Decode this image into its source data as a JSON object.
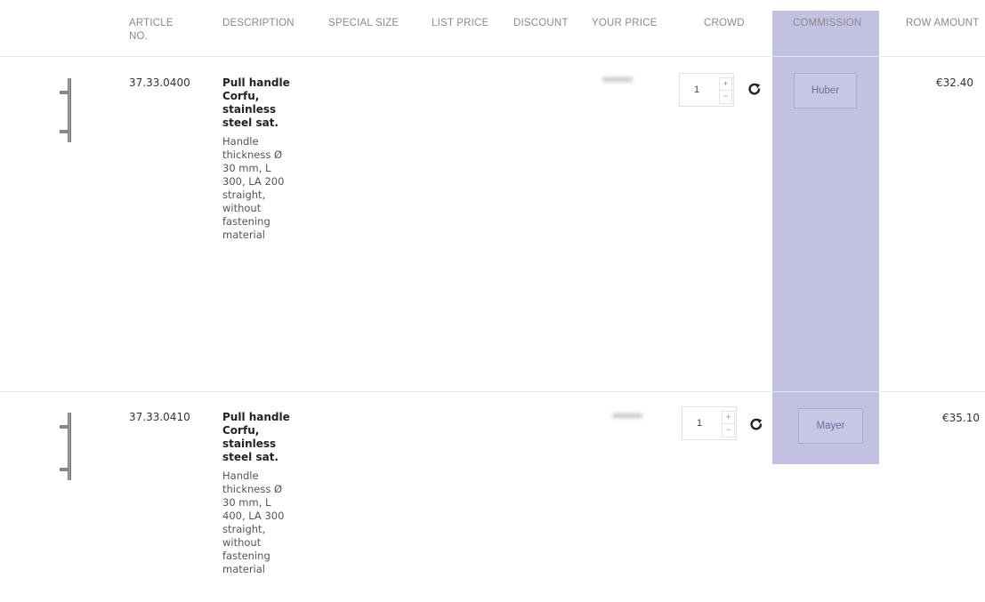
{
  "columns": {
    "article_no": "ARTICLE\nNO.",
    "description": "DESCRIPTION",
    "special_size": "SPECIAL SIZE",
    "list_price": "LIST PRICE",
    "discount": "DISCOUNT",
    "your_price": "YOUR PRICE",
    "crowd": "CROWD",
    "commission": "COMMISSION",
    "row_amount": "ROW AMOUNT"
  },
  "rows": [
    {
      "article_no": "37.33.0400",
      "name": "Pull handle Corfu, stainless steel sat.",
      "detail": "Handle thickness Ø 30 mm, L 300, LA 200 straight, without fastening material",
      "your_price": "€32.40",
      "crowd": "1",
      "commission": "Huber",
      "row_amount": "€32.40"
    },
    {
      "article_no": "37.33.0410",
      "name": "Pull handle Corfu, stainless steel sat.",
      "detail": "Handle thickness Ø 30 mm, L 400, LA 300 straight, without fastening material",
      "your_price": "€35.10",
      "crowd": "1",
      "commission": "Mayer",
      "row_amount": "€35.10"
    }
  ],
  "controls": {
    "plus": "+",
    "minus": "−"
  },
  "colors": {
    "commission_highlight": "#c3c1e2",
    "commission_field_border": "#aeacd2"
  },
  "icons": {
    "refresh": "refresh-icon",
    "product": "pull-handle-icon"
  }
}
